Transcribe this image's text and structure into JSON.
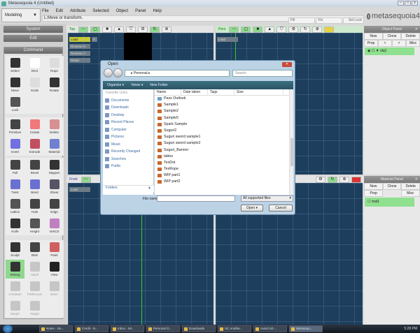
{
  "window": {
    "title": "Metasequoia 4 (Untitled)",
    "buttons": [
      "–",
      "□",
      "x"
    ]
  },
  "mode": {
    "value": "Modeling"
  },
  "menu": [
    "File",
    "Edit",
    "Attribute",
    "Selected",
    "Object",
    "Panel",
    "Help"
  ],
  "status": "L:Move or transform.",
  "fields": {
    "fill": "Fill",
    "vtx": "Vtx",
    "sel_lock": "Sel.Lock"
  },
  "logo": "metasequoia4",
  "left_panel": {
    "system": "System",
    "edit": "Edit",
    "command": "Command",
    "groups": [
      [
        {
          "label": "Select",
          "color": "#333"
        },
        {
          "label": "Rect",
          "color": "#fff"
        },
        {
          "label": "Rope",
          "color": "#ddd"
        },
        {
          "label": "Move",
          "color": "#333"
        },
        {
          "label": "Scale",
          "color": "#ddd"
        },
        {
          "label": "Rotate",
          "color": "#333"
        },
        {
          "label": "Lock",
          "color": "#555"
        }
      ],
      [
        {
          "label": "Primitive",
          "color": "#444"
        },
        {
          "label": "Create",
          "color": "#f07878"
        },
        {
          "label": "Delete",
          "color": "#d89090"
        },
        {
          "label": "Invert",
          "color": "#7070e0"
        },
        {
          "label": "Extrude",
          "color": "#c05060"
        },
        {
          "label": "Material",
          "color": "#7080d0"
        }
      ],
      [
        {
          "label": "Pull",
          "color": "#444"
        },
        {
          "label": "Bevel",
          "color": "#444"
        },
        {
          "label": "Magnet",
          "color": "#333"
        },
        {
          "label": "Twist",
          "color": "#6a70d0"
        },
        {
          "label": "Bend",
          "color": "#6a70d0"
        },
        {
          "label": "Shear",
          "color": "#556"
        },
        {
          "label": "Lattice",
          "color": "#555"
        },
        {
          "label": "Hole",
          "color": "#444"
        },
        {
          "label": "Edge",
          "color": "#444"
        },
        {
          "label": "Knife",
          "color": "#333"
        },
        {
          "label": "Height",
          "color": "#555"
        },
        {
          "label": "VertCtr",
          "color": "#c080c0"
        }
      ],
      [
        {
          "label": "Sculpt",
          "color": "#333"
        },
        {
          "label": "Blob",
          "color": "#444"
        },
        {
          "label": "Paint",
          "color": "#d06060"
        },
        {
          "label": "Writing",
          "color": "#333",
          "active": true
        },
        {
          "label": "Hatch",
          "color": "#999",
          "dim": true
        },
        {
          "label": "View",
          "color": "#222"
        },
        {
          "label": "Armature",
          "color": "#999",
          "dim": true
        },
        {
          "label": "PathCurve",
          "color": "#999",
          "dim": true
        },
        {
          "label": "Bone",
          "color": "#999",
          "dim": true
        },
        {
          "label": "Morph",
          "color": "#999",
          "dim": true
        },
        {
          "label": "Target",
          "color": "#999",
          "dim": true
        }
      ]
    ]
  },
  "viewports": {
    "top": "Top",
    "pers": "Pers",
    "front": "Front",
    "buttons": {
      "load": "Load",
      "x": "X",
      "reverse_h": "Reverse H",
      "reverse_v": "Reverse V",
      "reset": "Reset"
    },
    "toolbar_icons": [
      "grid-icon",
      "wireframe-icon",
      "face-icon",
      "light-icon",
      "shield-icon",
      "gear-icon",
      "refresh-icon",
      "zoom-move-icon",
      "display-toggle-icon"
    ]
  },
  "object_panel": {
    "title": "Object Panel",
    "buttons": [
      "New",
      "Clone",
      "Delete",
      "Prop",
      "<",
      ">",
      "Misc"
    ],
    "items": [
      {
        "name": "obj1"
      }
    ]
  },
  "material_panel": {
    "title": "Material Panel",
    "buttons": [
      "New",
      "Clone",
      "Delete",
      "Prop",
      "Misc"
    ],
    "items": [
      {
        "name": "mat1"
      }
    ]
  },
  "dialog": {
    "title": "Open",
    "path": "Personal",
    "search_placeholder": "Search",
    "toolbar": [
      "Organize ▾",
      "Views ▾",
      "New Folder"
    ],
    "favorites_title": "Favorite Links",
    "favorites": [
      "Documents",
      "Downloads",
      "Desktop",
      "Recent Places",
      "Computer",
      "Pictures",
      "Music",
      "Recently Changed",
      "Searches",
      "Public"
    ],
    "folders": "Folders",
    "columns": [
      "Name",
      "Date taken",
      "Tags",
      "Size"
    ],
    "files": [
      "Pass Outlook",
      "Sample1",
      "Sample2",
      "Sample5",
      "Spark Sample",
      "Suguri2",
      "Suguri sword sample1",
      "Suguri sword sample2",
      "Suguri_Banner",
      "tattoo",
      "TexDot",
      "TexRope",
      "WIP part1",
      "WIP part2"
    ],
    "file_name_label": "File name:",
    "file_name": "",
    "file_type": "All supported files",
    "open": "Open",
    "cancel": "Cancel"
  },
  "taskbar": {
    "tasks": [
      "Notes - De...",
      "Credit - N...",
      "Inbox - Mi...",
      "Personal O...",
      "Downloads",
      "SC Anothe...",
      "AutoCAD ...",
      "Metasequ..."
    ],
    "clock": "5:28 PM"
  }
}
